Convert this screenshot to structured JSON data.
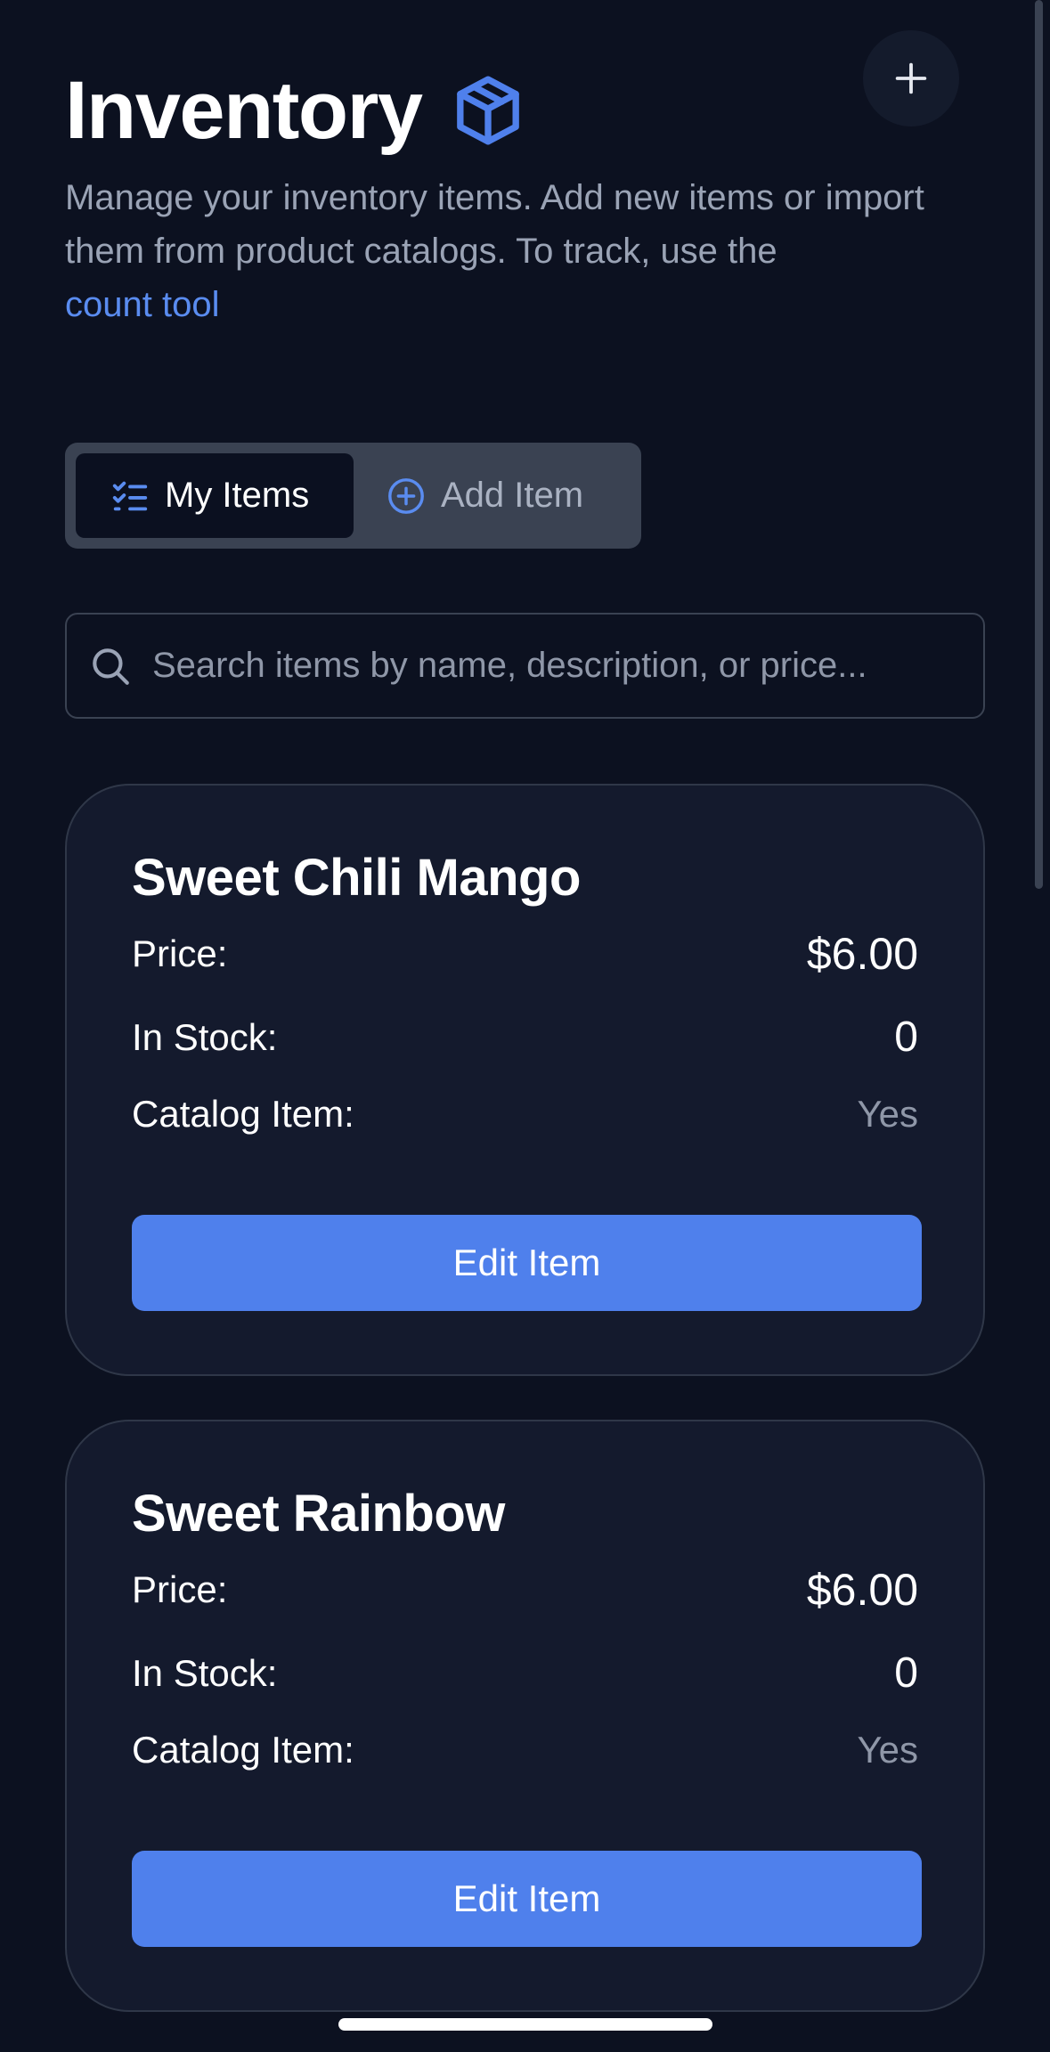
{
  "header": {
    "title": "Inventory",
    "subtitle_text": "Manage your inventory items. Add new items or import them from product catalogs. To track, use the",
    "subtitle_link": "count tool"
  },
  "tabs": [
    {
      "label": "My Items",
      "active": true
    },
    {
      "label": "Add Item",
      "active": false
    }
  ],
  "search": {
    "placeholder": "Search items by name, description, or price..."
  },
  "labels": {
    "price": "Price:",
    "in_stock": "In Stock:",
    "catalog_item": "Catalog Item:",
    "edit_button": "Edit Item"
  },
  "items": [
    {
      "name": "Sweet Chili Mango",
      "price": "$6.00",
      "in_stock": "0",
      "catalog_item": "Yes"
    },
    {
      "name": "Sweet Rainbow",
      "price": "$6.00",
      "in_stock": "0",
      "catalog_item": "Yes"
    }
  ],
  "colors": {
    "background": "#0c1120",
    "card": "#141a2d",
    "accent": "#4f80ec",
    "link": "#5a8cf0",
    "muted": "#8f97a8"
  },
  "icons": {
    "fab": "plus-icon",
    "title": "box-icon",
    "tab_my_items": "checklist-icon",
    "tab_add_item": "plus-circle-icon",
    "search": "search-icon"
  }
}
